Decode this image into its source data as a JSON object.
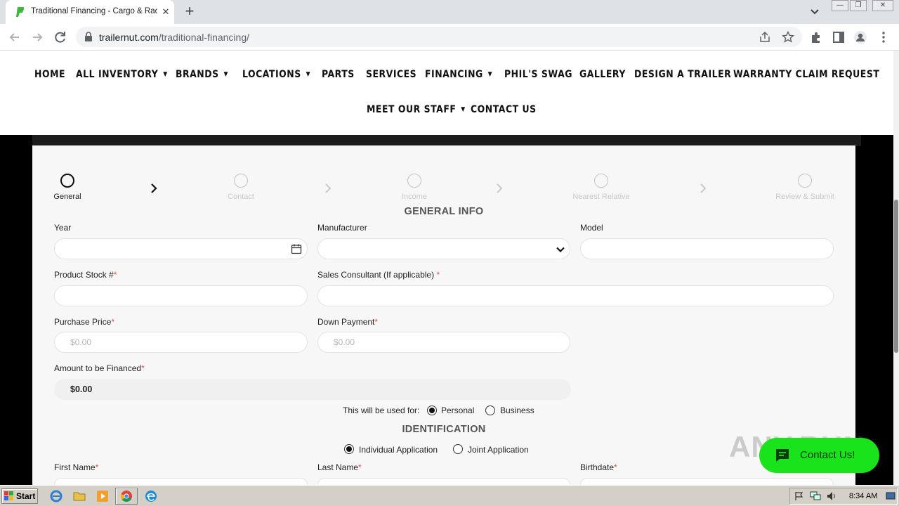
{
  "browser": {
    "tab_title": "Traditional Financing - Cargo & Racing",
    "url_host": "trailernut.com",
    "url_path": "/traditional-financing/"
  },
  "nav": {
    "row1": [
      {
        "label": "HOME",
        "has_menu": false
      },
      {
        "label": "ALL INVENTORY",
        "has_menu": true
      },
      {
        "label": "BRANDS",
        "has_menu": true
      },
      {
        "label": "LOCATIONS",
        "has_menu": true
      },
      {
        "label": "PARTS",
        "has_menu": false
      },
      {
        "label": "SERVICES",
        "has_menu": false
      },
      {
        "label": "FINANCING",
        "has_menu": true
      },
      {
        "label": "PHIL'S SWAG",
        "has_menu": false
      },
      {
        "label": "GALLERY",
        "has_menu": false
      },
      {
        "label": "DESIGN A TRAILER",
        "has_menu": false
      },
      {
        "label": "WARRANTY CLAIM REQUEST",
        "has_menu": false
      }
    ],
    "row2": [
      {
        "label": "MEET OUR STAFF",
        "has_menu": true
      },
      {
        "label": "CONTACT US",
        "has_menu": false
      }
    ]
  },
  "steps": [
    {
      "label": "General",
      "active": true
    },
    {
      "label": "Contact",
      "active": false
    },
    {
      "label": "Income",
      "active": false
    },
    {
      "label": "Nearest Relative",
      "active": false
    },
    {
      "label": "Review & Submit",
      "active": false
    }
  ],
  "form": {
    "general_title": "GENERAL INFO",
    "year_label": "Year",
    "manufacturer_label": "Manufacturer",
    "model_label": "Model",
    "stock_label": "Product Stock #",
    "consultant_label": "Sales Consultant (If applicable)",
    "purchase_label": "Purchase Price",
    "purchase_placeholder": "$0.00",
    "down_label": "Down Payment",
    "down_placeholder": "$0.00",
    "financed_label": "Amount to be Financed",
    "financed_value": "$0.00",
    "usage_label": "This will be used for:",
    "usage_options": [
      "Personal",
      "Business"
    ],
    "usage_selected": "Personal",
    "identification_title": "IDENTIFICATION",
    "application_options": [
      "Individual Application",
      "Joint Application"
    ],
    "application_selected": "Individual Application",
    "first_name_label": "First Name",
    "last_name_label": "Last Name",
    "birthdate_label": "Birthdate",
    "required_mark": "*"
  },
  "watermark": "ANY.RUN",
  "chat": {
    "label": "Contact Us!"
  },
  "taskbar": {
    "start_label": "Start",
    "clock": "8:34 AM"
  },
  "colors": {
    "accent_green": "#19e31a",
    "required_red": "#d9534f"
  }
}
